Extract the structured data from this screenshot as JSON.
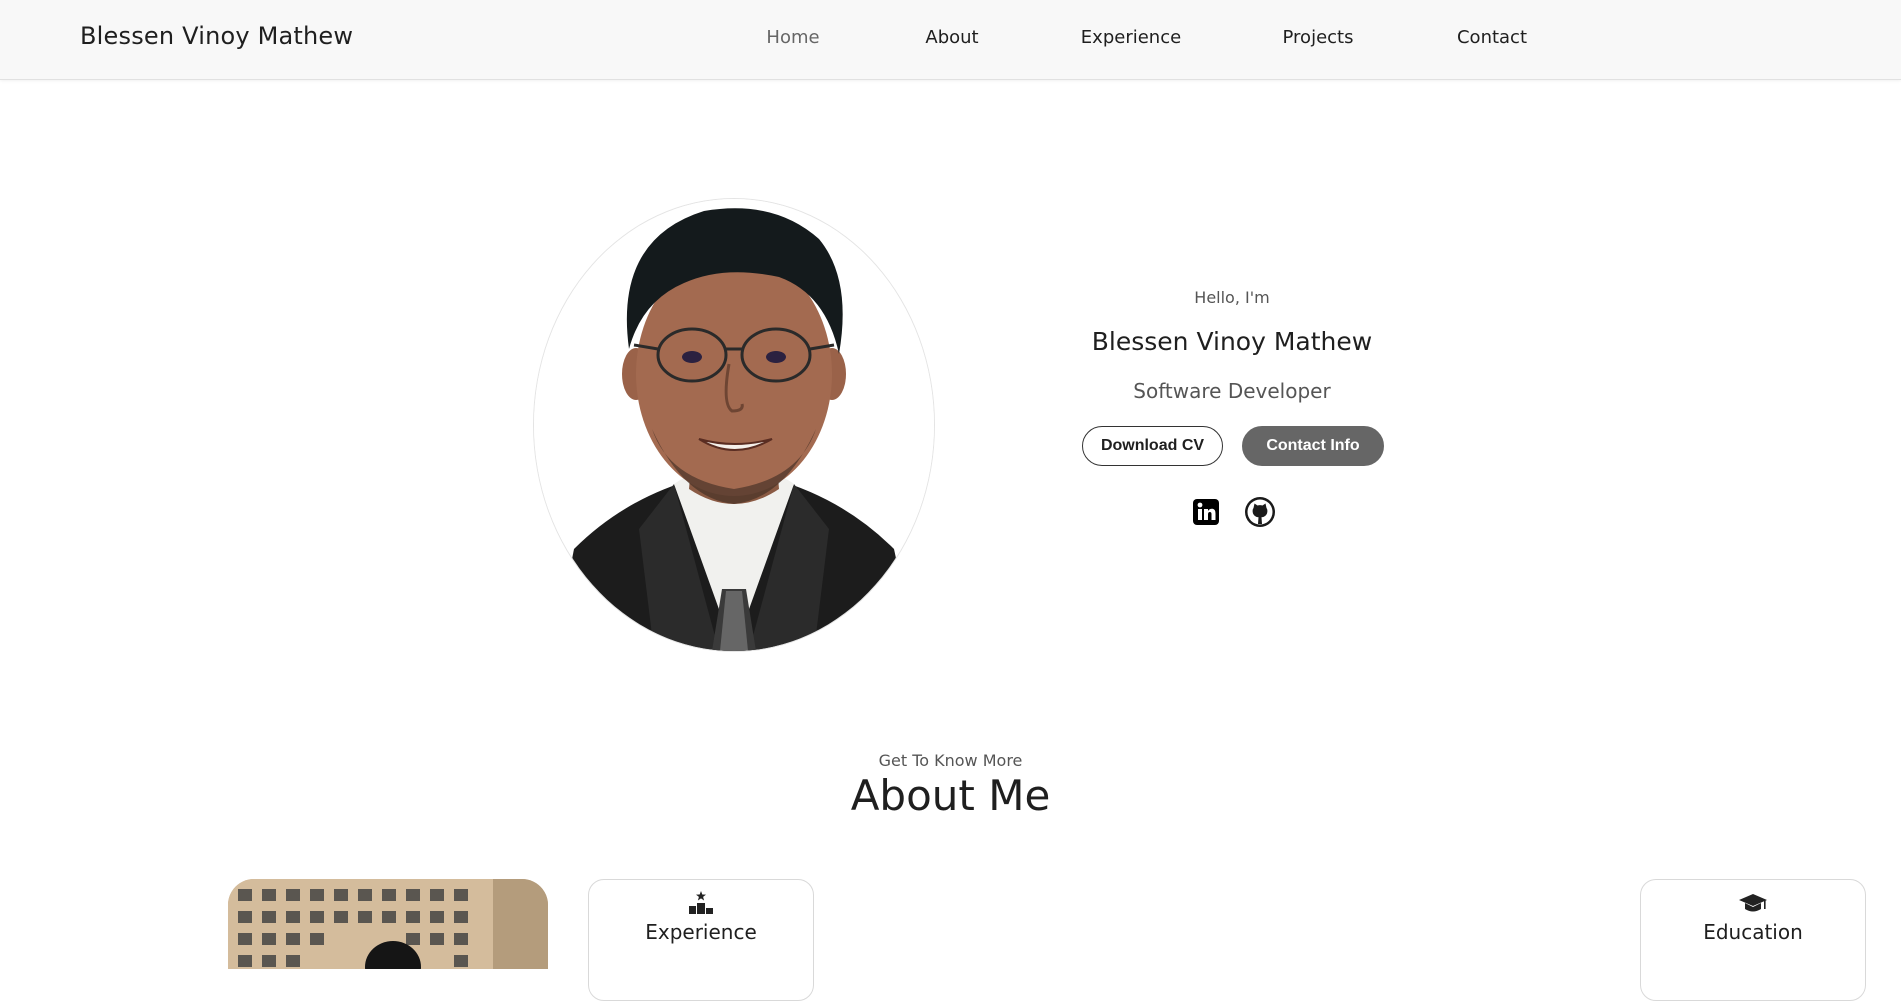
{
  "header": {
    "logo": "Blessen Vinoy Mathew"
  },
  "nav": {
    "links": [
      "Home",
      "About",
      "Experience",
      "Projects",
      "Contact"
    ],
    "active": "Home"
  },
  "hero": {
    "greeting": "Hello, I'm",
    "name": "Blessen Vinoy Mathew",
    "role": "Software Developer",
    "buttons": {
      "download_cv": "Download CV",
      "contact_info": "Contact Info"
    },
    "socials": [
      "linkedin-icon",
      "github-icon"
    ]
  },
  "about": {
    "subtitle": "Get To Know More",
    "title": "About Me",
    "cards": [
      {
        "icon": "experience-icon",
        "title": "Experience"
      },
      {
        "icon": "graduation-cap-icon",
        "title": "Education"
      }
    ]
  },
  "colors": {
    "nav_bg": "#f8f8f8",
    "accent_button": "#666666",
    "text_dark": "#1f1f1f",
    "text_muted": "#555555"
  }
}
